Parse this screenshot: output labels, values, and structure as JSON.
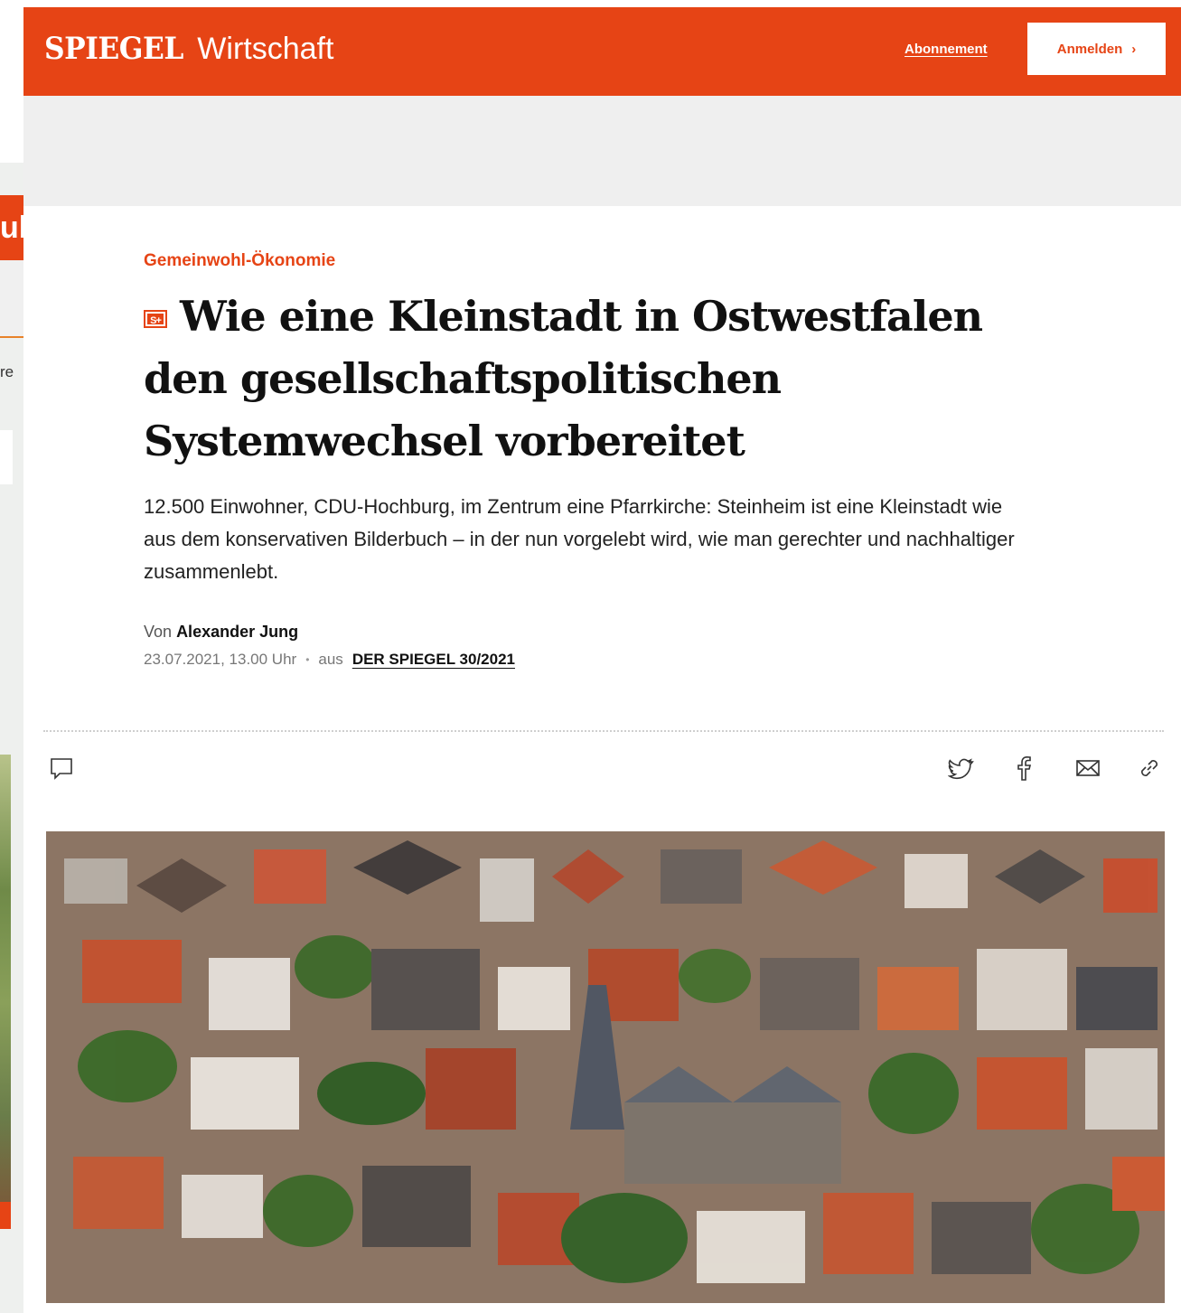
{
  "header": {
    "logo": "SPIEGEL",
    "section": "Wirtschaft",
    "subscription_link": "Abonnement",
    "login_button": "Anmelden",
    "login_chevron": "›"
  },
  "background_window": {
    "tab_text": "ul",
    "side_text": "re"
  },
  "article": {
    "kicker": "Gemeinwohl-Ökonomie",
    "badge": "S+",
    "headline": "Wie eine Kleinstadt in Ostwestfalen den gesellschaftspolitischen Systemwechsel vorbereitet",
    "lede": "12.500 Einwohner, CDU-Hochburg, im Zentrum eine Pfarrkirche: Steinheim ist eine Kleinstadt wie aus dem konservativen Bilderbuch – in der nun vorgelebt wird, wie man gerechter und nachhaltiger zusammenlebt.",
    "byline_prefix": "Von",
    "author": "Alexander Jung",
    "date": "23.07.2021, 13.00 Uhr",
    "meta_separator": "•",
    "issue_prefix": "aus",
    "issue": "DER SPIEGEL 30/2021"
  },
  "toolbar": {
    "comment_icon": "comment-icon",
    "share_icons": [
      "twitter-icon",
      "facebook-icon",
      "mail-icon",
      "link-icon"
    ]
  },
  "colors": {
    "brand": "#e64415",
    "text": "#111111",
    "ad_band": "#efefef"
  }
}
